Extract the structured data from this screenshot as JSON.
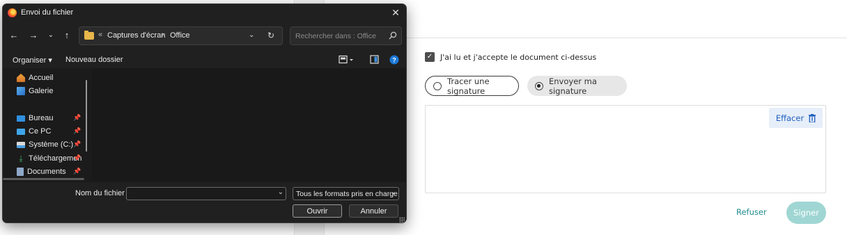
{
  "background_page": {
    "consent_label": "J'ai lu et j'accepte le document ci-dessus",
    "option_draw": "Tracer une signature",
    "option_send": "Envoyer ma signature",
    "clear_label": "Effacer",
    "refuse_label": "Refuser",
    "sign_label": "Signer"
  },
  "dialog": {
    "title": "Envoi du fichier",
    "breadcrumb": {
      "prefix": "«",
      "items": [
        "Captures d'écran",
        "Office"
      ]
    },
    "search_placeholder": "Rechercher dans : Office",
    "toolbar": {
      "organize": "Organiser",
      "new_folder": "Nouveau dossier"
    },
    "sidebar": {
      "items": [
        {
          "label": "Accueil",
          "icon": "home-icon"
        },
        {
          "label": "Galerie",
          "icon": "gallery-icon"
        },
        {
          "label": "Bureau",
          "icon": "desktop-icon"
        },
        {
          "label": "Ce PC",
          "icon": "computer-icon"
        },
        {
          "label": "Système (C:)",
          "icon": "drive-icon"
        },
        {
          "label": "Téléchargemen",
          "icon": "download-icon"
        },
        {
          "label": "Documents",
          "icon": "documents-icon"
        }
      ]
    },
    "filename_label": "Nom du fichier :",
    "filename_value": "",
    "filter_value": "Tous les formats pris en charge",
    "open_label": "Ouvrir",
    "cancel_label": "Annuler"
  },
  "colors": {
    "accent_teal": "#1f8c8c",
    "sign_button": "#9fd6d3",
    "clear_blue": "#1f5fbf",
    "dialog_bg": "#202020"
  }
}
